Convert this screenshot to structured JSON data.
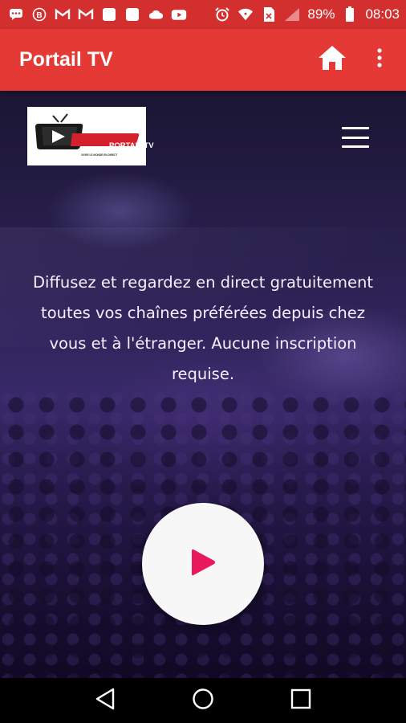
{
  "status_bar": {
    "battery": "89%",
    "time": "08:03",
    "left_icons": [
      "chat-icon",
      "bitcoin-icon",
      "gmail-icon",
      "gmail-icon",
      "app-icon",
      "app-icon",
      "cloud-icon",
      "youtube-icon"
    ],
    "right_icons": [
      "alarm-icon",
      "wifi-icon",
      "no-sim-icon",
      "signal-icon",
      "battery-icon"
    ]
  },
  "app_bar": {
    "title": "Portail TV",
    "actions": [
      "home-icon",
      "more-vert-icon"
    ]
  },
  "web": {
    "logo": {
      "brand": "PORTAIL TV",
      "tagline": "VIVRE LE MONDE EN DIRECT"
    },
    "hero_text": "Diffusez et regardez en direct gratuitement toutes vos chaînes préférées depuis chez vous et à l'étranger. Aucune inscription requise."
  },
  "colors": {
    "status_bar": "#d32f2f",
    "app_bar": "#e53935",
    "play_accent": "#e8195a",
    "background_purple": "#3a2a6c"
  },
  "nav_bar": [
    "back-icon",
    "home-circle-icon",
    "recents-icon"
  ]
}
